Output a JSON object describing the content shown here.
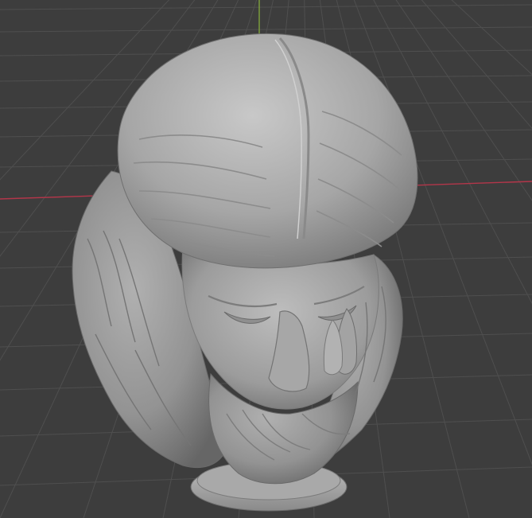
{
  "viewport": {
    "mode": "3d-viewport",
    "shading": "solid",
    "object": "sculpted-bust",
    "colors": {
      "background": "#3d3d3d",
      "grid_line": "#505050",
      "x_axis": "#b3364a",
      "y_axis": "#7fa33c",
      "mesh_light": "#b9b9b9",
      "mesh_mid": "#9e9e9e",
      "mesh_dark": "#6f6f6f"
    }
  }
}
